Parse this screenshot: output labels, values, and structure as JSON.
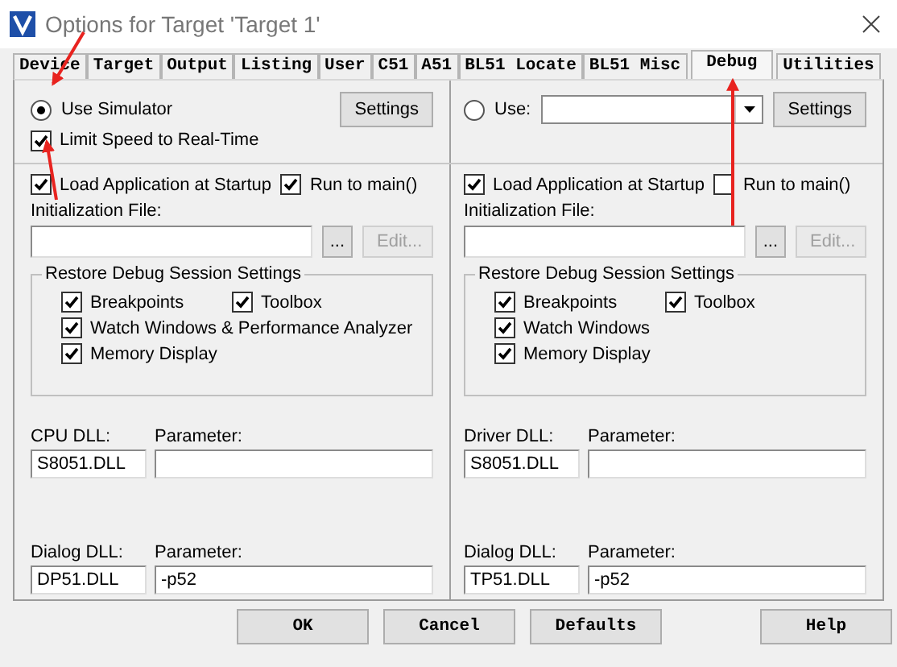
{
  "window": {
    "title": "Options for Target 'Target 1'"
  },
  "tabs": [
    {
      "label": "Device",
      "selected": false
    },
    {
      "label": "Target",
      "selected": false
    },
    {
      "label": "Output",
      "selected": false
    },
    {
      "label": "Listing",
      "selected": false
    },
    {
      "label": "User",
      "selected": false
    },
    {
      "label": "C51",
      "selected": false
    },
    {
      "label": "A51",
      "selected": false
    },
    {
      "label": "BL51 Locate",
      "selected": false
    },
    {
      "label": "BL51 Misc",
      "selected": false
    },
    {
      "label": "Debug",
      "selected": true
    },
    {
      "label": "Utilities",
      "selected": false
    }
  ],
  "panels": [
    {
      "mode": {
        "label": "Use Simulator",
        "selected": true
      },
      "settings_button": "Settings",
      "limit_speed": {
        "label": "Limit Speed to Real-Time",
        "checked": true
      },
      "load_application": {
        "label": "Load Application at Startup",
        "checked": true
      },
      "run_to_main": {
        "label": "Run to main()",
        "checked": true
      },
      "init_file": {
        "label": "Initialization File:",
        "browse_button": "...",
        "edit_button": {
          "label": "Edit...",
          "disabled": true
        }
      },
      "restore": {
        "title": "Restore Debug Session Settings",
        "rows": [
          [
            {
              "label": "Breakpoints",
              "checked": true
            },
            {
              "label": "Toolbox",
              "checked": true
            }
          ],
          [
            {
              "label": "Watch Windows & Performance Analyzer",
              "checked": true
            }
          ],
          [
            {
              "label": "Memory Display",
              "checked": true
            }
          ]
        ]
      },
      "dlls": [
        {
          "label": "CPU DLL:",
          "value": "S8051.DLL",
          "parameter_label": "Parameter:"
        },
        {
          "label": "Dialog DLL:",
          "value": "DP51.DLL",
          "parameter_label": "Parameter:",
          "parameter": "-p52"
        }
      ]
    },
    {
      "mode": {
        "label": "Use:",
        "selected": false
      },
      "has_dropdown": true,
      "settings_button": "Settings",
      "load_application": {
        "label": "Load Application at Startup",
        "checked": true
      },
      "run_to_main": {
        "label": "Run to main()",
        "checked": false
      },
      "init_file": {
        "label": "Initialization File:",
        "browse_button": "...",
        "edit_button": {
          "label": "Edit...",
          "disabled": true
        }
      },
      "restore": {
        "title": "Restore Debug Session Settings",
        "rows": [
          [
            {
              "label": "Breakpoints",
              "checked": true
            },
            {
              "label": "Toolbox",
              "checked": true
            }
          ],
          [
            {
              "label": "Watch Windows",
              "checked": true
            }
          ],
          [
            {
              "label": "Memory Display",
              "checked": true
            }
          ]
        ]
      },
      "dlls": [
        {
          "label": "Driver DLL:",
          "value": "S8051.DLL",
          "parameter_label": "Parameter:"
        },
        {
          "label": "Dialog DLL:",
          "value": "TP51.DLL",
          "parameter_label": "Parameter:",
          "parameter": "-p52"
        }
      ]
    }
  ],
  "buttons": [
    "OK",
    "Cancel",
    "Defaults",
    "Help"
  ]
}
